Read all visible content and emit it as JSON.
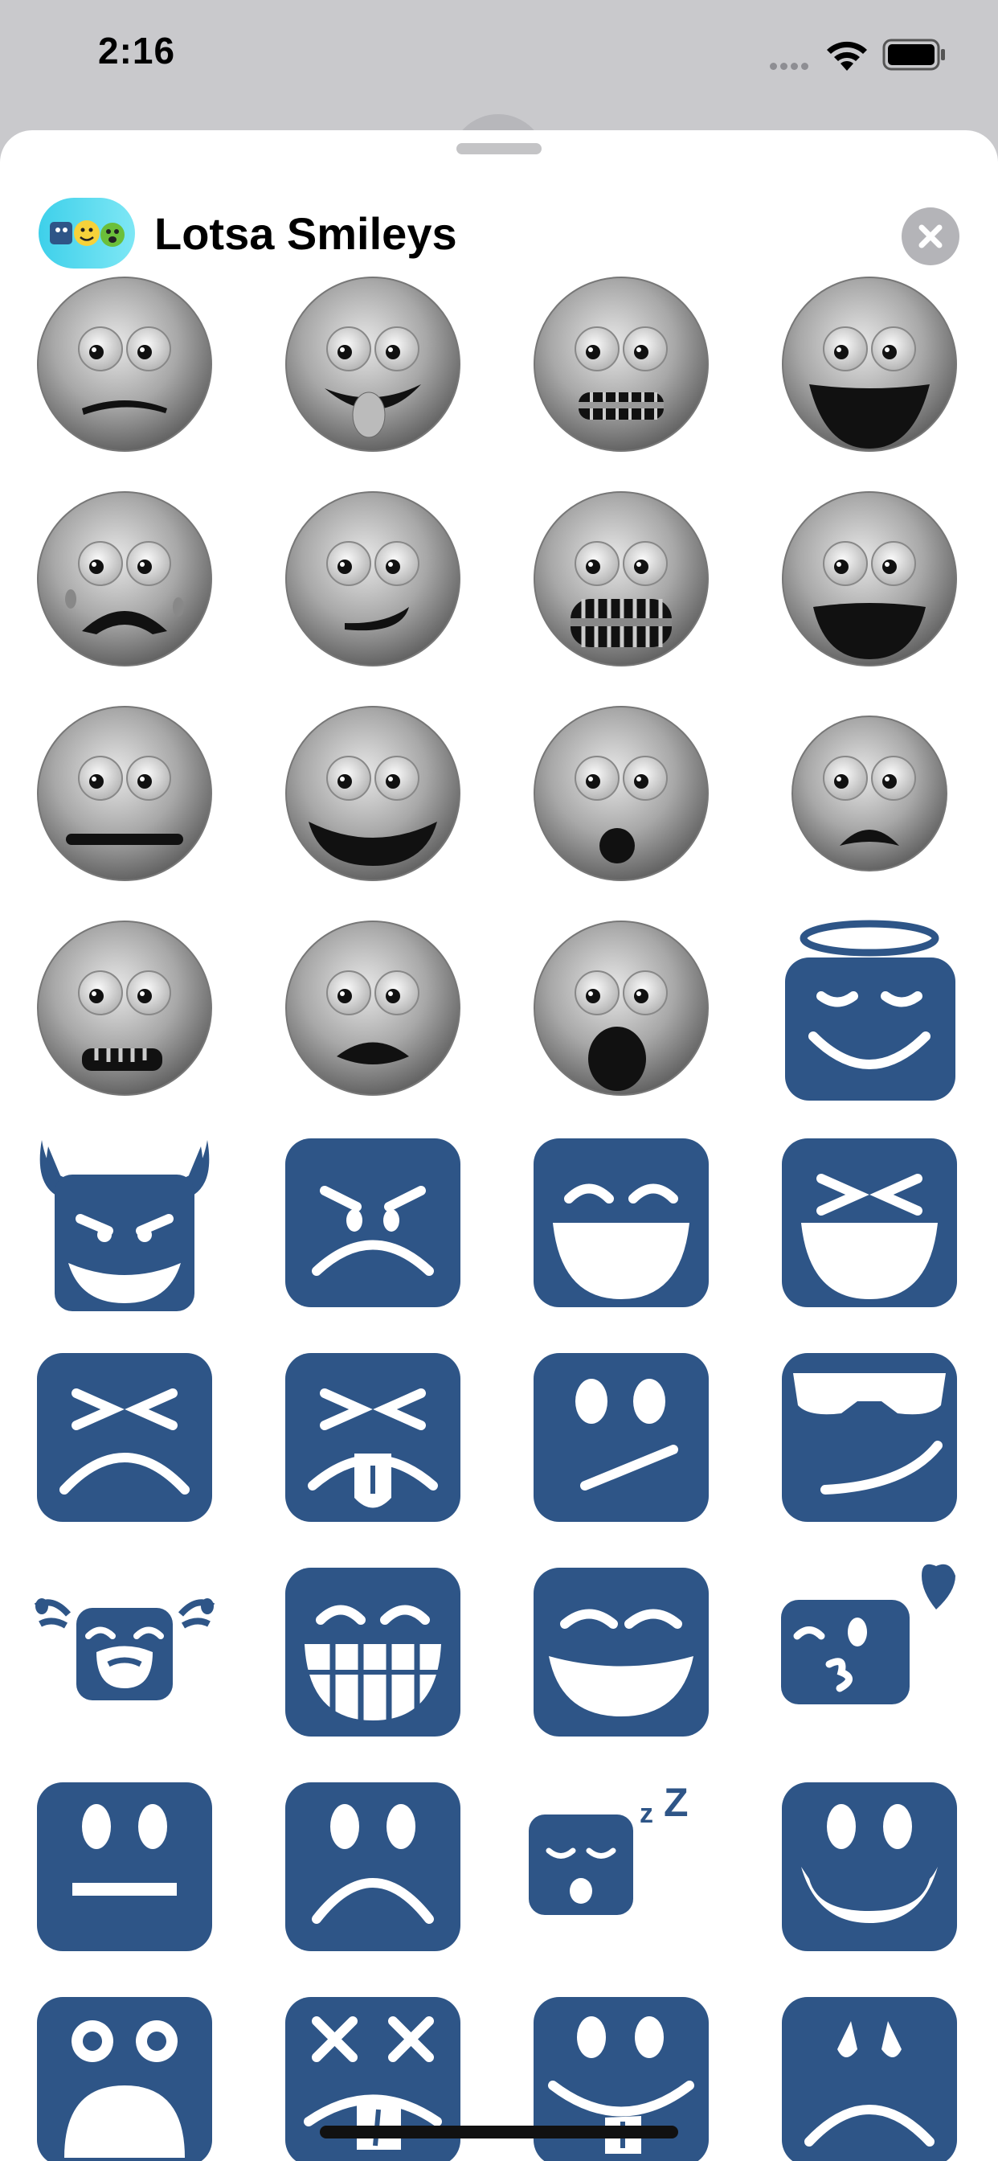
{
  "status_bar": {
    "time": "2:16"
  },
  "sheet": {
    "app_name": "Lotsa Smileys"
  },
  "colors": {
    "blue": "#2e5587",
    "sheet": "#ffffff",
    "backdrop": "#c9c9cc"
  },
  "stickers": [
    "gray-smiley-frown-slight",
    "gray-smiley-tongue",
    "gray-smiley-grimace",
    "gray-smiley-grin",
    "gray-smiley-crying",
    "gray-smiley-smirk",
    "gray-smiley-teeth",
    "gray-smiley-open-mouth",
    "gray-smiley-neutral",
    "gray-smiley-smile",
    "gray-smiley-surprised",
    "gray-smiley-sad-small",
    "gray-smiley-braces",
    "gray-smiley-pout",
    "gray-smiley-shocked",
    "blue-angel",
    "blue-devil",
    "blue-angry",
    "blue-laugh",
    "blue-squint-laugh",
    "blue-squint-frown",
    "blue-squint-tongue",
    "blue-skeptical",
    "blue-sunglasses",
    "blue-sobbing",
    "blue-big-grin",
    "blue-happy",
    "blue-kiss-heart",
    "blue-neutral",
    "blue-sad",
    "blue-sleeping",
    "blue-smile",
    "blue-shocked",
    "blue-dead-tongue",
    "blue-silly-tongue",
    "blue-worried"
  ]
}
